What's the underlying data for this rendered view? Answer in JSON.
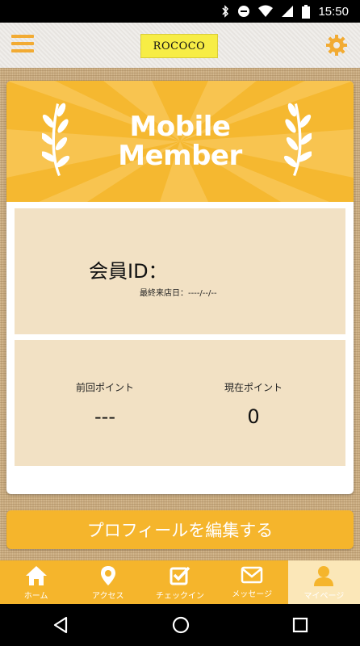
{
  "status_bar": {
    "time": "15:50"
  },
  "app_bar": {
    "logo_text": "ROCOCO"
  },
  "banner": {
    "title_line1": "Mobile",
    "title_line2": "Member"
  },
  "member": {
    "id_label": "会員ID：",
    "last_visit": "最終来店日：----/--/--"
  },
  "points": {
    "previous_label": "前回ポイント",
    "previous_value": "---",
    "current_label": "現在ポイント",
    "current_value": "0"
  },
  "edit_profile_label": "プロフィールを編集する",
  "bottom_nav": {
    "items": [
      {
        "label": "ホーム",
        "icon": "home-icon"
      },
      {
        "label": "アクセス",
        "icon": "map-pin-icon"
      },
      {
        "label": "チェックイン",
        "icon": "checkbox-icon"
      },
      {
        "label": "メッセージ",
        "icon": "envelope-icon"
      },
      {
        "label": "マイページ",
        "icon": "person-icon",
        "active": true
      }
    ]
  },
  "colors": {
    "accent": "#f5b52c",
    "panel": "#f2e1c4",
    "logo_bg": "#f7ed45"
  }
}
